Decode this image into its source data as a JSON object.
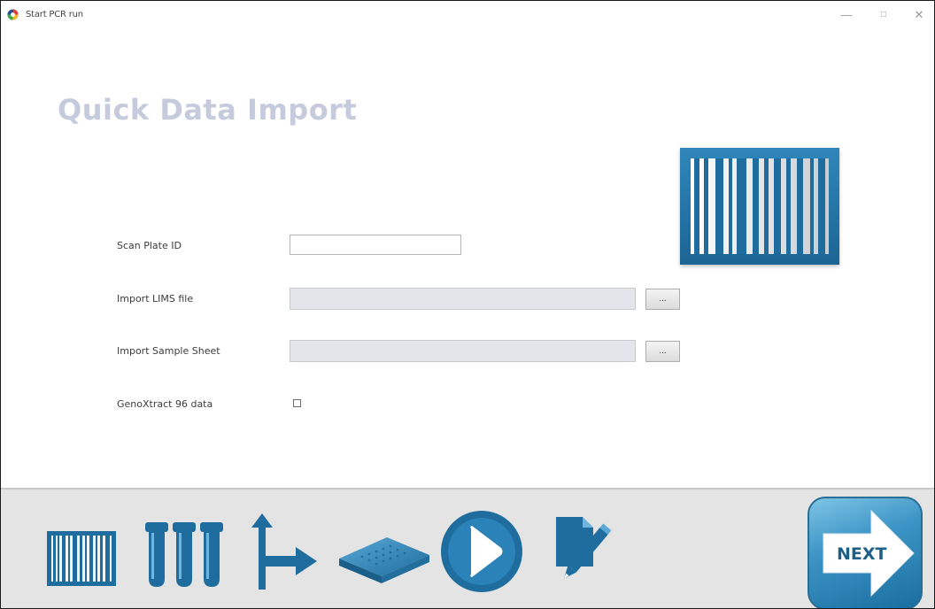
{
  "window": {
    "title": "Start PCR run"
  },
  "page": {
    "title": "Quick Data Import"
  },
  "form": {
    "scan_plate_label": "Scan Plate ID",
    "scan_plate_value": "",
    "lims_label": "Import LIMS file",
    "lims_value": "",
    "lims_browse_label": "...",
    "sample_sheet_label": "Import Sample Sheet",
    "sample_sheet_value": "",
    "sample_sheet_browse_label": "...",
    "genoxtract_label": "GenoXtract 96 data",
    "genoxtract_checked": false
  },
  "footer": {
    "icons": [
      "barcode-icon",
      "tubes-icon",
      "branch-arrow-icon",
      "plate-icon",
      "play-icon",
      "edit-document-icon"
    ],
    "next_label": "NEXT"
  },
  "colors": {
    "accent": "#1d6d9e",
    "accent_light": "#5aaad6",
    "title": "#c5cbdc",
    "footer_bg": "#e4e4e4",
    "field_bg": "#e3e5ea"
  }
}
